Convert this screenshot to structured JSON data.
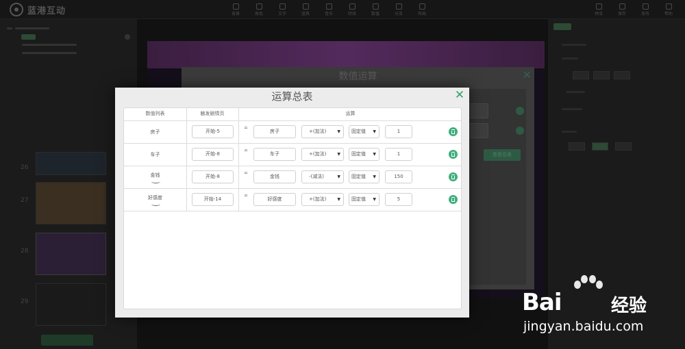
{
  "app": {
    "logo": "蓝港互动"
  },
  "toolbar": {
    "tools": [
      "背景",
      "角色",
      "文字",
      "道具",
      "音乐",
      "特效",
      "数值",
      "分支",
      "布局"
    ],
    "right_tools": [
      "预览",
      "保存",
      "发布",
      "帮助"
    ]
  },
  "left_panel": {
    "thumb_numbers": [
      "26",
      "27",
      "28",
      "29"
    ]
  },
  "secondary_dialog": {
    "title": "数值运算",
    "close": "✕",
    "view_button": "查看总表"
  },
  "modal": {
    "title": "运算总表",
    "close": "✕",
    "headers": {
      "values": "数值列表",
      "trigger": "触发剧情页",
      "operation": "运算"
    },
    "rows": [
      {
        "name": "房子",
        "trigger": "开始-5",
        "variable": "房子",
        "operator": "+(加法)",
        "type": "固定值",
        "amount": "1",
        "expand": false
      },
      {
        "name": "车子",
        "trigger": "开始-8",
        "variable": "车子",
        "operator": "+(加法)",
        "type": "固定值",
        "amount": "1",
        "expand": false
      },
      {
        "name": "金钱",
        "trigger": "开始-8",
        "variable": "金钱",
        "operator": "-(减法)",
        "type": "固定值",
        "amount": "150",
        "expand": true
      },
      {
        "name": "好感度",
        "trigger": "开始-14",
        "variable": "好感度",
        "operator": "+(加法)",
        "type": "固定值",
        "amount": "5",
        "expand": true
      }
    ],
    "equals_sign": "=",
    "dropdown_arrow": "▼"
  },
  "watermark": {
    "brand": "Bai",
    "brand_suffix": "经验",
    "url": "jingyan.baidu.com"
  },
  "colors": {
    "accent": "#3fae7c",
    "modal_bg": "#ececec"
  }
}
